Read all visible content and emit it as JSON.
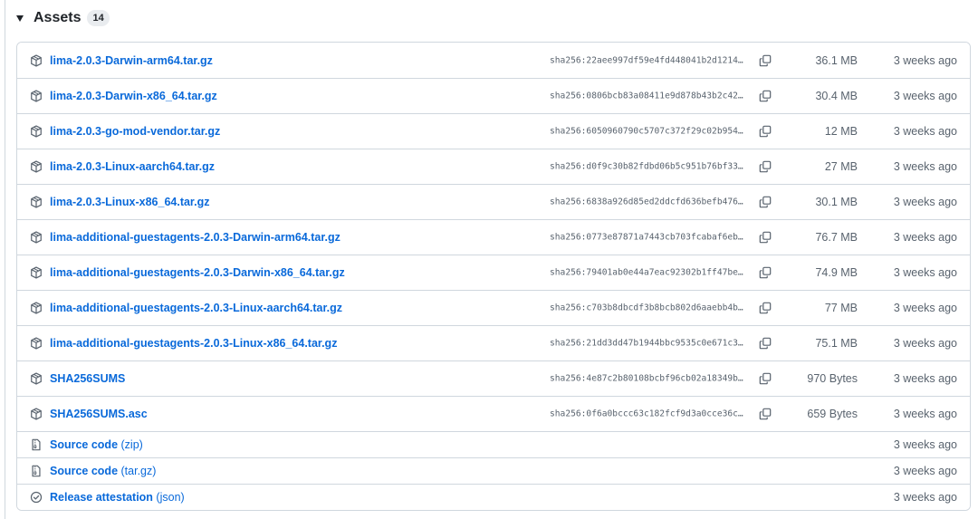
{
  "assets": {
    "title": "Assets",
    "count": "14"
  },
  "rows": [
    {
      "name": "lima-2.0.3-Darwin-arm64.tar.gz",
      "icon": "package-icon",
      "sha": "sha256:22aee997df59e4fd448041b2d1214…",
      "size": "36.1 MB",
      "date": "3 weeks ago"
    },
    {
      "name": "lima-2.0.3-Darwin-x86_64.tar.gz",
      "icon": "package-icon",
      "sha": "sha256:0806bcb83a08411e9d878b43b2c42…",
      "size": "30.4 MB",
      "date": "3 weeks ago"
    },
    {
      "name": "lima-2.0.3-go-mod-vendor.tar.gz",
      "icon": "package-icon",
      "sha": "sha256:6050960790c5707c372f29c02b954…",
      "size": "12 MB",
      "date": "3 weeks ago"
    },
    {
      "name": "lima-2.0.3-Linux-aarch64.tar.gz",
      "icon": "package-icon",
      "sha": "sha256:d0f9c30b82fdbd06b5c951b76bf33…",
      "size": "27 MB",
      "date": "3 weeks ago"
    },
    {
      "name": "lima-2.0.3-Linux-x86_64.tar.gz",
      "icon": "package-icon",
      "sha": "sha256:6838a926d85ed2ddcfd636befb476…",
      "size": "30.1 MB",
      "date": "3 weeks ago"
    },
    {
      "name": "lima-additional-guestagents-2.0.3-Darwin-arm64.tar.gz",
      "icon": "package-icon",
      "sha": "sha256:0773e87871a7443cb703fcabaf6eb…",
      "size": "76.7 MB",
      "date": "3 weeks ago"
    },
    {
      "name": "lima-additional-guestagents-2.0.3-Darwin-x86_64.tar.gz",
      "icon": "package-icon",
      "sha": "sha256:79401ab0e44a7eac92302b1ff47be…",
      "size": "74.9 MB",
      "date": "3 weeks ago"
    },
    {
      "name": "lima-additional-guestagents-2.0.3-Linux-aarch64.tar.gz",
      "icon": "package-icon",
      "sha": "sha256:c703b8dbcdf3b8bcb802d6aaebb4b…",
      "size": "77 MB",
      "date": "3 weeks ago"
    },
    {
      "name": "lima-additional-guestagents-2.0.3-Linux-x86_64.tar.gz",
      "icon": "package-icon",
      "sha": "sha256:21dd3dd47b1944bbc9535c0e671c3…",
      "size": "75.1 MB",
      "date": "3 weeks ago"
    },
    {
      "name": "SHA256SUMS",
      "icon": "package-icon",
      "sha": "sha256:4e87c2b80108bcbf96cb02a18349b…",
      "size": "970 Bytes",
      "date": "3 weeks ago"
    },
    {
      "name": "SHA256SUMS.asc",
      "icon": "package-icon",
      "sha": "sha256:0f6a0bccc63c182fcf9d3a0cce36c…",
      "size": "659 Bytes",
      "date": "3 weeks ago"
    },
    {
      "name": "Source code",
      "suffix": "(zip)",
      "icon": "file-zip-icon",
      "date": "3 weeks ago"
    },
    {
      "name": "Source code",
      "suffix": "(tar.gz)",
      "icon": "file-zip-icon",
      "date": "3 weeks ago"
    },
    {
      "name": "Release attestation",
      "suffix": "(json)",
      "icon": "verified-check-icon",
      "date": "3 weeks ago"
    }
  ],
  "colors": {
    "link": "#0969da",
    "muted": "#59636e",
    "border": "#d0d7de",
    "badge_bg": "#e9ecef"
  }
}
